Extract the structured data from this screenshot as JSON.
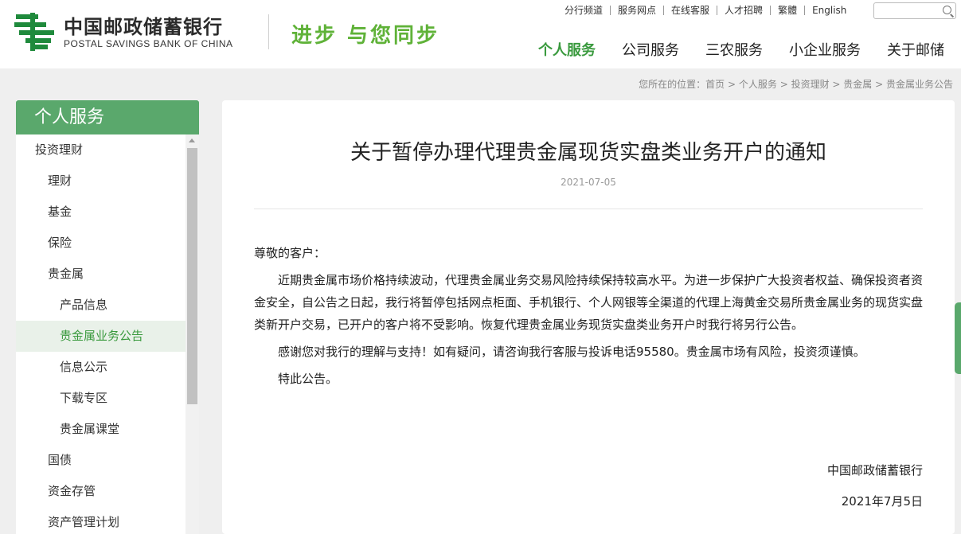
{
  "header": {
    "logo_cn": "中国邮政储蓄银行",
    "logo_en": "POSTAL SAVINGS BANK OF CHINA",
    "slogan": "进步 与您同步",
    "top_links": [
      "分行频道",
      "服务网点",
      "在线客服",
      "人才招聘",
      "繁體",
      "English"
    ],
    "search_placeholder": "",
    "main_nav": [
      "个人服务",
      "公司服务",
      "三农服务",
      "小企业服务",
      "关于邮储"
    ],
    "main_nav_active": "个人服务"
  },
  "breadcrumb": {
    "prefix": "您所在的位置：",
    "items": [
      "首页",
      "个人服务",
      "投资理财",
      "贵金属",
      "贵金属业务公告"
    ],
    "separator": " > "
  },
  "sidebar": {
    "title": "个人服务",
    "items": [
      {
        "label": "投资理财",
        "level": 1
      },
      {
        "label": "理财",
        "level": 2
      },
      {
        "label": "基金",
        "level": 2
      },
      {
        "label": "保险",
        "level": 2
      },
      {
        "label": "贵金属",
        "level": 2
      },
      {
        "label": "产品信息",
        "level": 3
      },
      {
        "label": "贵金属业务公告",
        "level": 3,
        "active": true
      },
      {
        "label": "信息公示",
        "level": 3
      },
      {
        "label": "下载专区",
        "level": 3
      },
      {
        "label": "贵金属课堂",
        "level": 3
      },
      {
        "label": "国债",
        "level": 2
      },
      {
        "label": "资金存管",
        "level": 2
      },
      {
        "label": "资产管理计划",
        "level": 2
      }
    ]
  },
  "article": {
    "title": "关于暂停办理代理贵金属现货实盘类业务开户的通知",
    "date": "2021-07-05",
    "salutation": "尊敬的客户：",
    "paragraphs": [
      "近期贵金属市场价格持续波动，代理贵金属业务交易风险持续保持较高水平。为进一步保护广大投资者权益、确保投资者资金安全，自公告之日起，我行将暂停包括网点柜面、手机银行、个人网银等全渠道的代理上海黄金交易所贵金属业务的现货实盘类新开户交易，已开户的客户将不受影响。恢复代理贵金属业务现货实盘类业务开户时我行将另行公告。",
      "感谢您对我行的理解与支持！如有疑问，请咨询我行客服与投诉电话95580。贵金属市场有风险，投资须谨慎。",
      "特此公告。"
    ],
    "signature": "中国邮政储蓄银行",
    "sign_date": "2021年7月5日"
  },
  "colors": {
    "brand_green": "#5aa86c",
    "active_green": "#3a9a3e",
    "slogan_green": "#5fb238"
  }
}
